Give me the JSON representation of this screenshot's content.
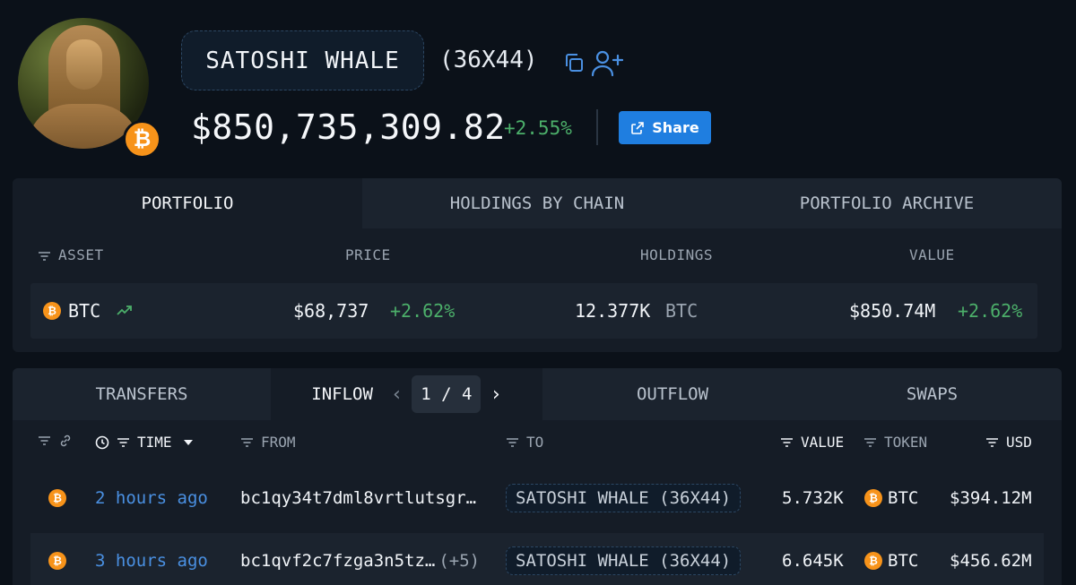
{
  "profile": {
    "name": "SATOSHI WHALE",
    "id_suffix": "(36X44)",
    "total_value": "$850,735,309.82",
    "total_change": "+2.55%",
    "share_label": "Share",
    "badge_symbol": "₿"
  },
  "portfolio_tabs": [
    "PORTFOLIO",
    "HOLDINGS BY CHAIN",
    "PORTFOLIO ARCHIVE"
  ],
  "portfolio_columns": {
    "asset": "ASSET",
    "price": "PRICE",
    "holdings": "HOLDINGS",
    "value": "VALUE"
  },
  "assets": [
    {
      "symbol": "BTC",
      "coin_glyph": "₿",
      "price": "$68,737",
      "price_change": "+2.62%",
      "holdings": "12.377K",
      "holdings_unit": "BTC",
      "value": "$850.74M",
      "value_change": "+2.62%"
    }
  ],
  "transfer_tabs": {
    "transfers": "TRANSFERS",
    "inflow": "INFLOW",
    "page_current": "1",
    "page_sep": "/",
    "page_total": "4",
    "outflow": "OUTFLOW",
    "swaps": "SWAPS"
  },
  "transfer_columns": {
    "time": "TIME",
    "from": "FROM",
    "to": "TO",
    "value": "VALUE",
    "token": "TOKEN",
    "usd": "USD"
  },
  "transfers": [
    {
      "time": "2 hours ago",
      "from": "bc1qy34t7dml8vrtlutsgr…",
      "from_extra": "",
      "to": "SATOSHI WHALE (36X44)",
      "value": "5.732K",
      "token": "BTC",
      "usd": "$394.12M"
    },
    {
      "time": "3 hours ago",
      "from": "bc1qvf2c7fzga3n5tz…",
      "from_extra": "(+5)",
      "to": "SATOSHI WHALE (36X44)",
      "value": "6.645K",
      "token": "BTC",
      "usd": "$456.62M"
    }
  ],
  "colors": {
    "accent": "#1f7ee0",
    "positive": "#4caf6a",
    "btc": "#f7931a",
    "link": "#4a90e2"
  },
  "icons": [
    "copy-icon",
    "add-user-icon",
    "external-link-icon",
    "filter-icon",
    "link-icon",
    "clock-icon",
    "caret-down-icon",
    "trend-up-icon",
    "chevron-left-icon",
    "chevron-right-icon",
    "btc-icon"
  ]
}
